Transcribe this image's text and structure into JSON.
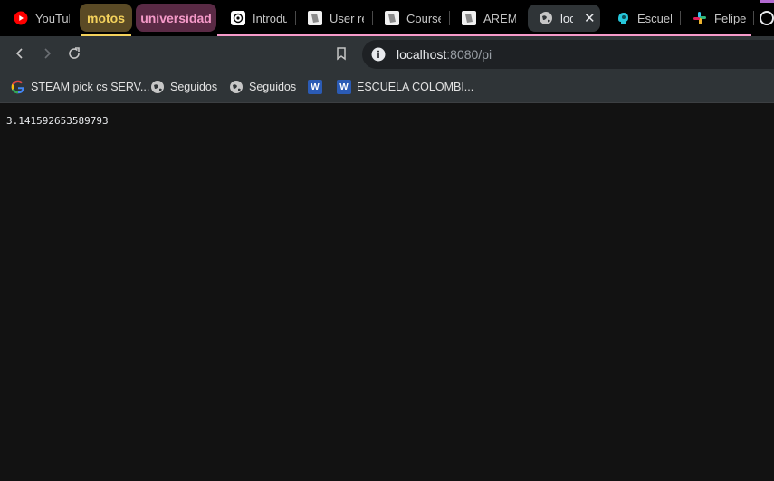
{
  "tabs": {
    "youtube": "YouTube",
    "group_motos": "motos",
    "group_universidad": "universidad",
    "intro": "Introdu",
    "user": "User re",
    "course": "Course",
    "arems": "AREMs",
    "active": "loc",
    "escuela": "Escuela",
    "felipe": "Felipe"
  },
  "colors": {
    "motos_bg": "#5a4a25",
    "motos_text": "#f4d25c",
    "universidad_bg": "#5a2a45",
    "universidad_text": "#f59ac9"
  },
  "toolbar": {
    "url_host": "localhost",
    "url_path": ":8080/pi"
  },
  "bookmarks": {
    "b1": "STEAM pick cs SERV...",
    "b2": "Seguidos",
    "b3": "Seguidos",
    "b5": "ESCUELA COLOMBI..."
  },
  "page": {
    "content": "3.141592653589793"
  }
}
